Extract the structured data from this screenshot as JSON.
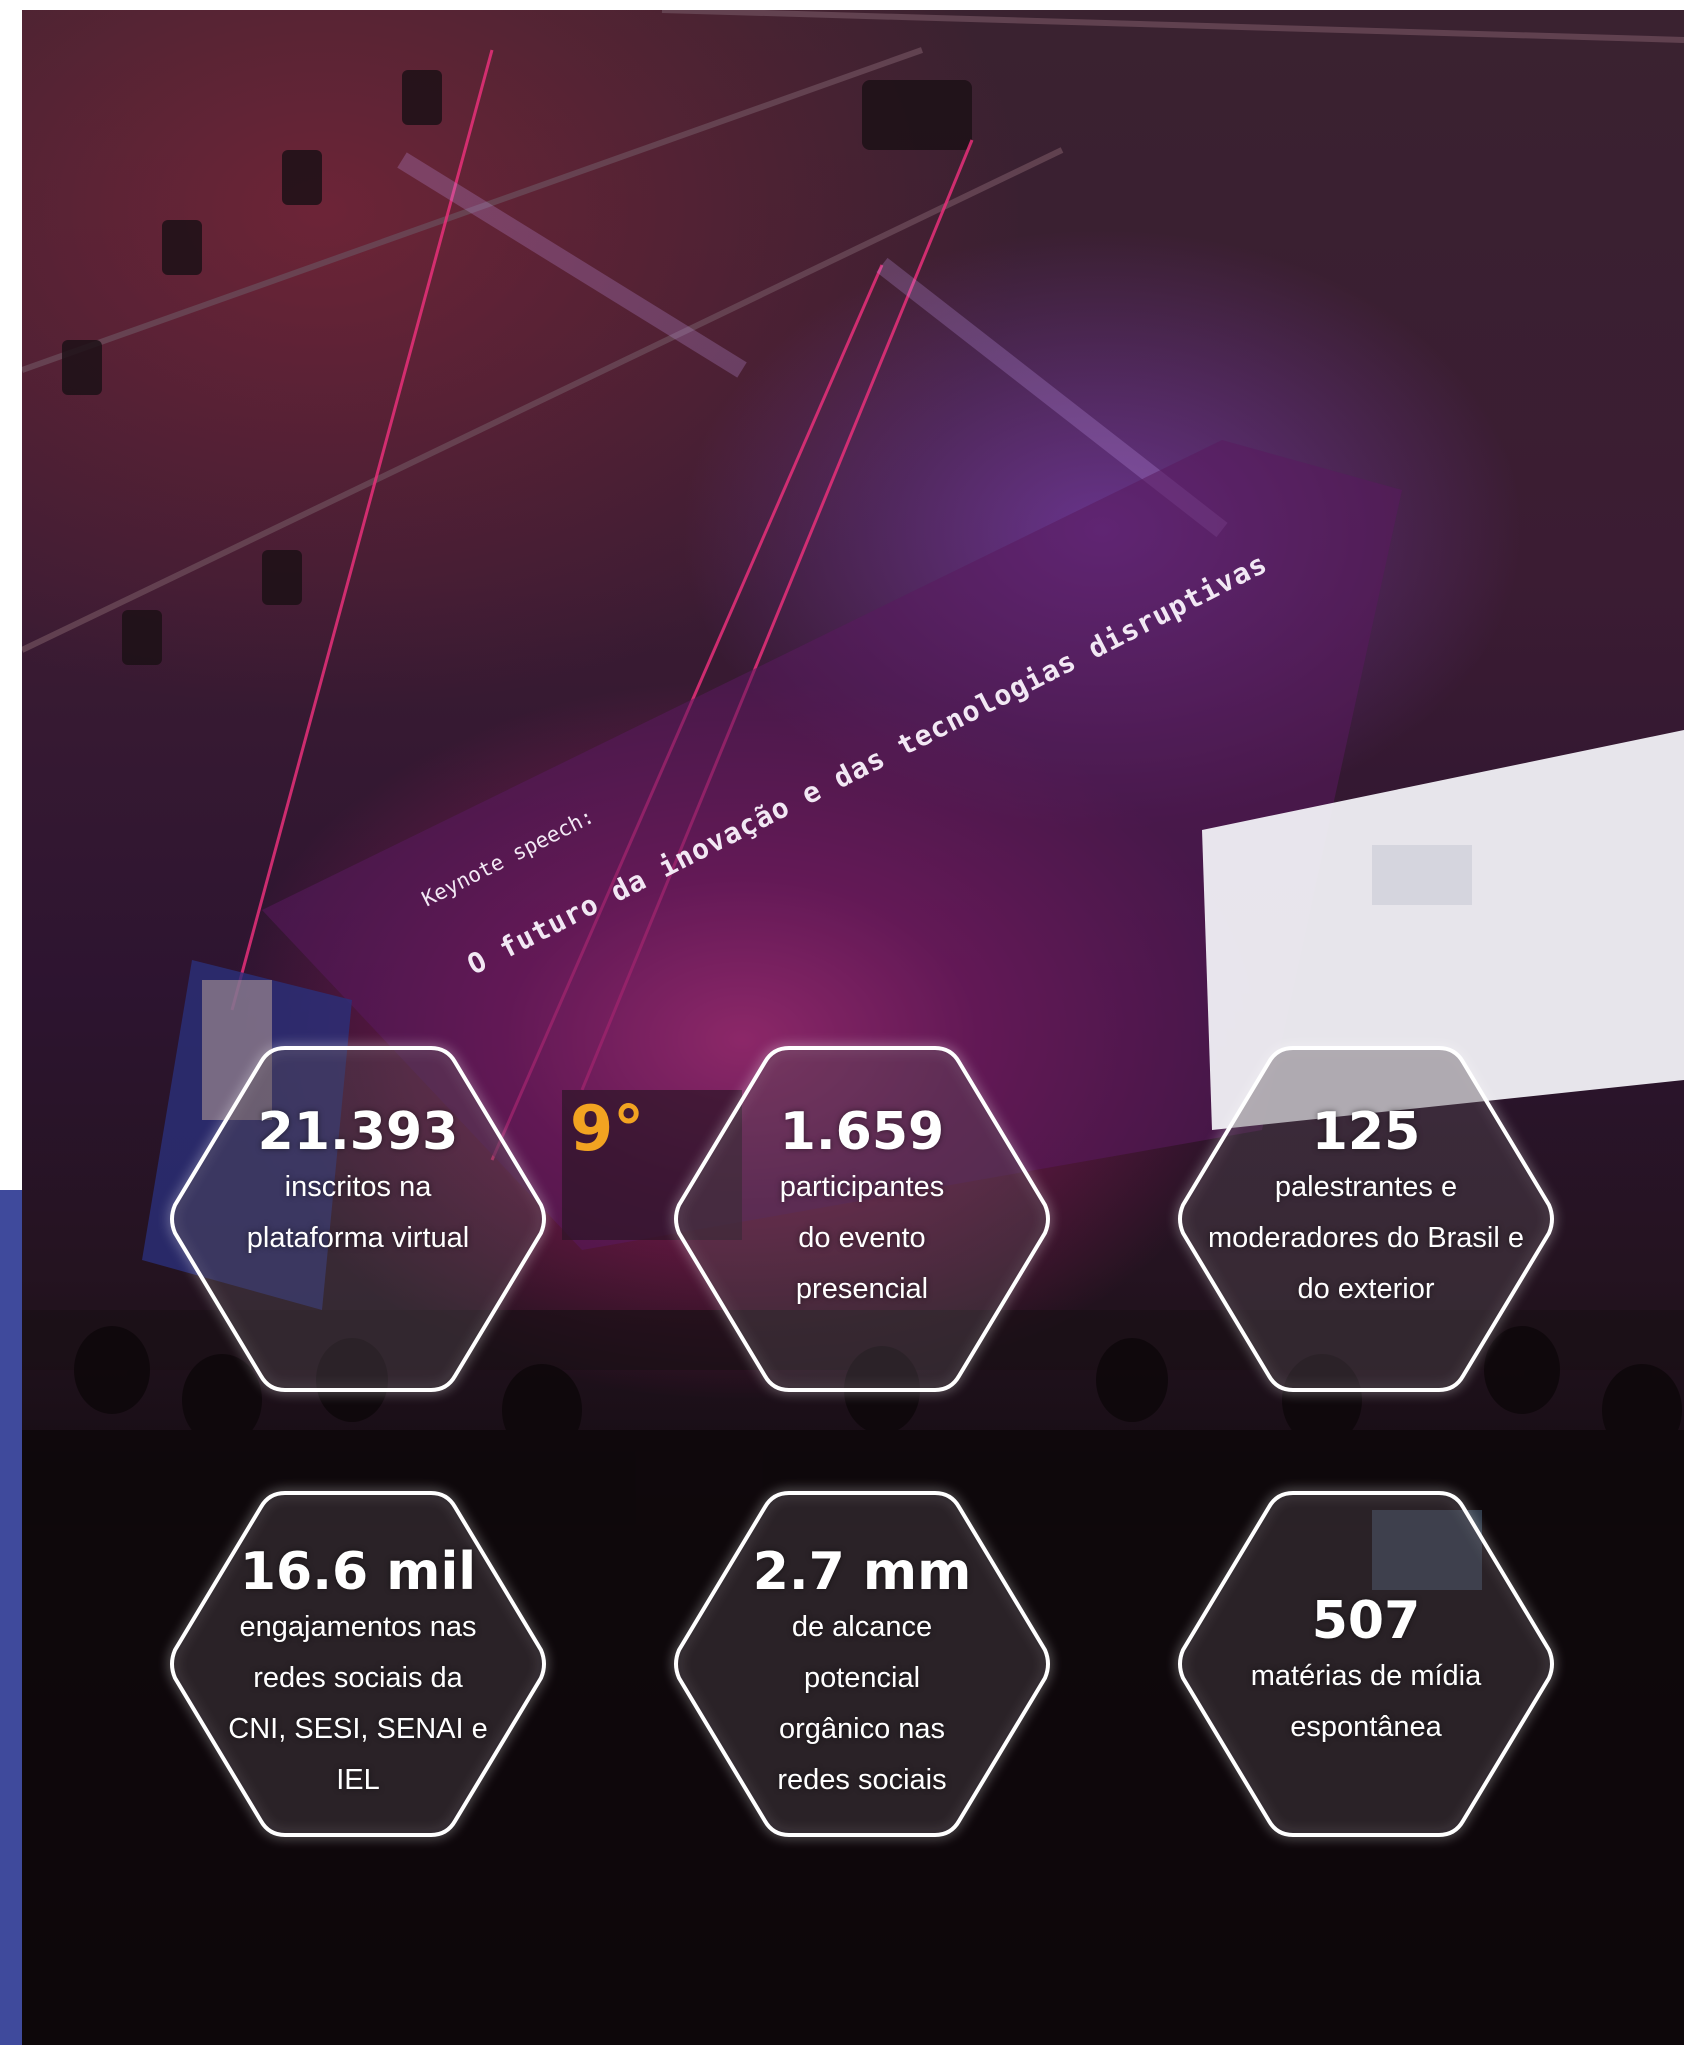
{
  "stage_screen": {
    "keynote_label": "Keynote speech:",
    "keynote_title": "O futuro da inovação e das tecnologias disruptivas"
  },
  "stats": [
    {
      "number": "21.393",
      "description": "inscritos na plataforma virtual"
    },
    {
      "number": "1.659",
      "description": "participantes do evento presencial"
    },
    {
      "number": "125",
      "description": "palestrantes e moderadores do Brasil e do exterior"
    },
    {
      "number": "16.6 mil",
      "description": "engajamentos nas redes sociais da CNI, SESI, SENAI e IEL"
    },
    {
      "number": "2.7 mm",
      "description": "de alcance potencial orgânico nas redes sociais"
    },
    {
      "number": "507",
      "description": "matérias de mídia espontânea"
    }
  ],
  "colors": {
    "accent_bar": "#3f4a9c",
    "hex_outline": "#ffffff",
    "stage_magenta": "#e8307a"
  }
}
